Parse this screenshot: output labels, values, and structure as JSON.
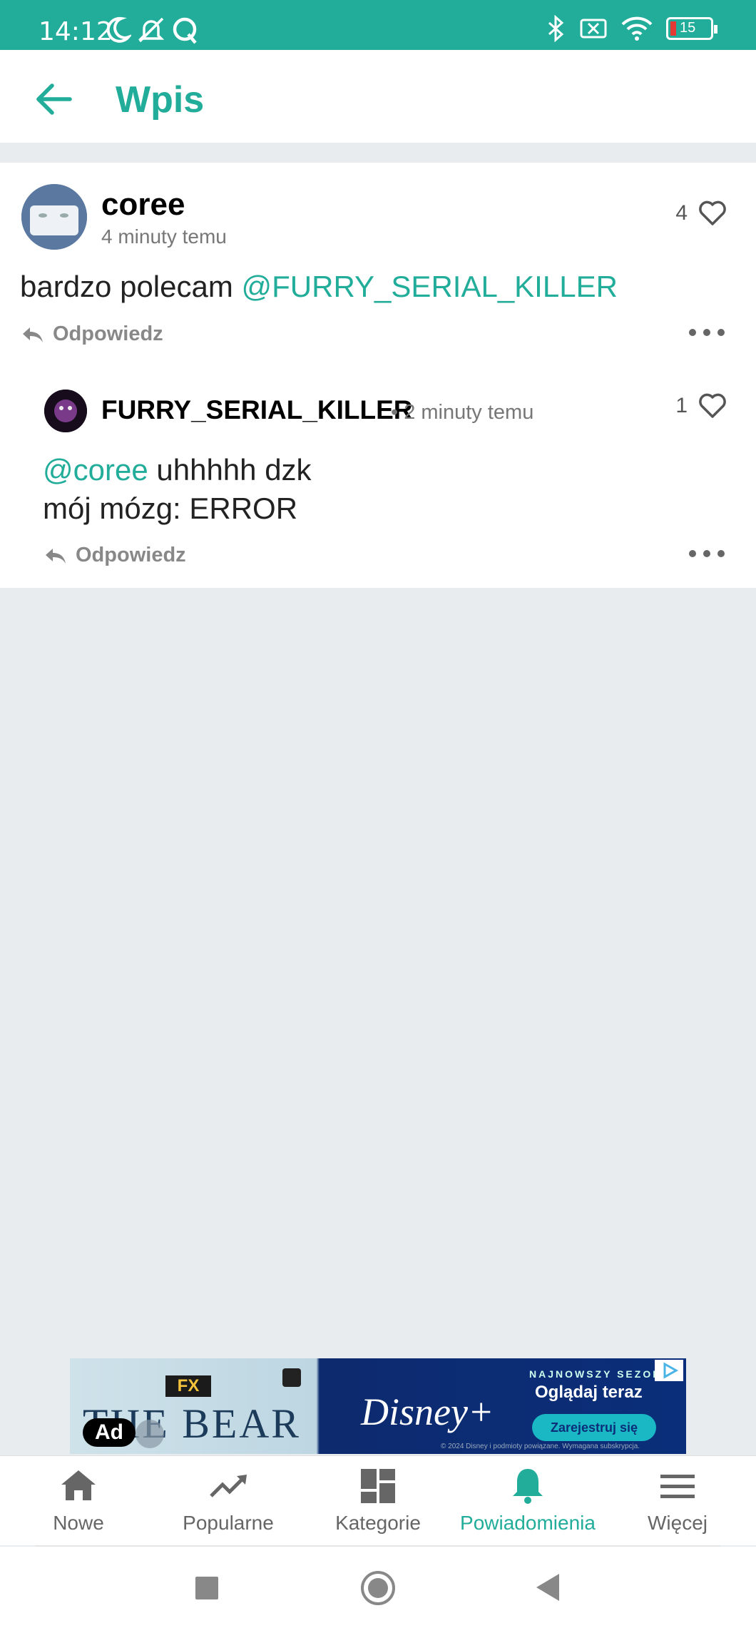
{
  "status_bar": {
    "time": "14:12",
    "battery_level": "15",
    "icons": [
      "moon-icon",
      "bell-off-icon",
      "q-icon",
      "bluetooth-icon",
      "sim-off-icon",
      "wifi-icon",
      "battery-icon"
    ]
  },
  "header": {
    "title": "Wpis",
    "back_icon": "arrow-left-icon"
  },
  "post": {
    "author": "coree",
    "time": "4 minuty temu",
    "likes": "4",
    "text": "bardzo polecam ",
    "mention": "@FURRY_SERIAL_KILLER",
    "reply_label": "Odpowiedz"
  },
  "reply": {
    "author": "FURRY_SERIAL_KILLER",
    "time": "• 2 minuty temu",
    "likes": "1",
    "mention": "@coree",
    "text_line1": " uhhhhh dzk",
    "text_line2": "mój mózg: ERROR",
    "reply_label": "Odpowiedz"
  },
  "ad": {
    "badge": "Ad",
    "fx": "FX",
    "show": "THE BEAR",
    "brand": "Disney+",
    "tagline": "NAJNOWSZY SEZON",
    "headline": "Oglądaj teraz",
    "cta": "Zarejestruj się",
    "fine_print": "© 2024 Disney i podmioty powiązane. Wymagana subskrypcja."
  },
  "bottom_nav": {
    "items": [
      {
        "label": "Nowe",
        "icon": "home-icon"
      },
      {
        "label": "Popularne",
        "icon": "trending-icon"
      },
      {
        "label": "Kategorie",
        "icon": "dashboard-icon"
      },
      {
        "label": "Powiadomienia",
        "icon": "bell-icon",
        "active": true
      },
      {
        "label": "Więcej",
        "icon": "menu-icon"
      }
    ]
  },
  "colors": {
    "accent": "#21ad9a",
    "background": "#e8ecee"
  }
}
